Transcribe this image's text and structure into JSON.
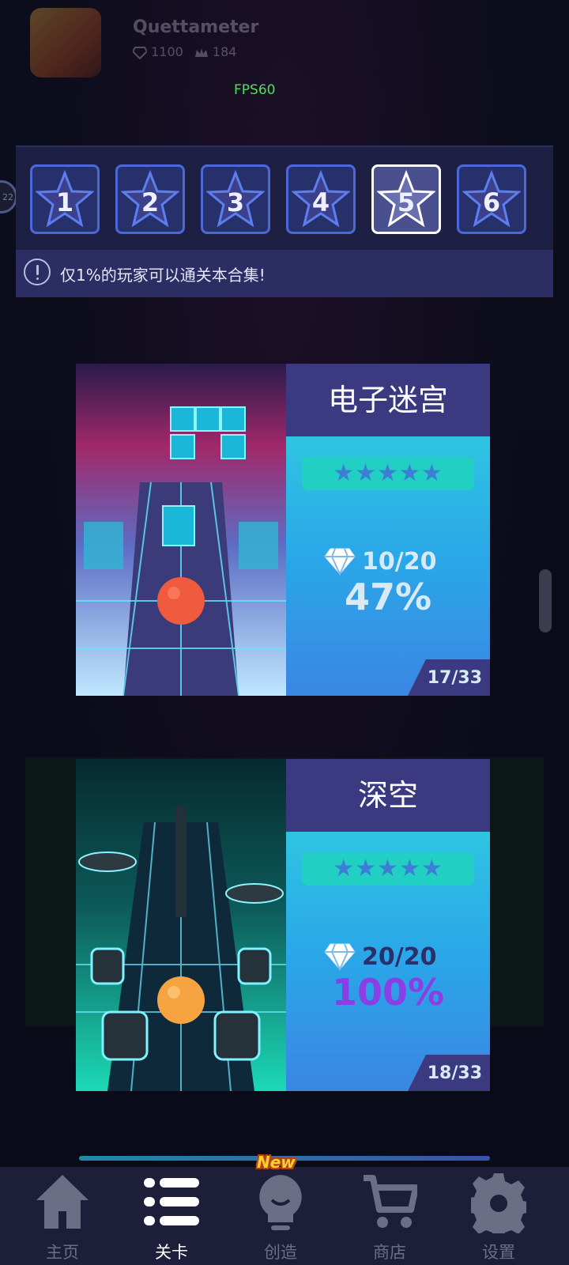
{
  "profile": {
    "name": "Quettameter",
    "gems": "1100",
    "crowns": "184"
  },
  "fps": "FPS60",
  "collection": {
    "tabs": [
      {
        "num": "1"
      },
      {
        "num": "2"
      },
      {
        "num": "3"
      },
      {
        "num": "4"
      },
      {
        "num": "5"
      },
      {
        "num": "6"
      }
    ],
    "selected_tab": "5",
    "notice_text": "仅1%的玩家可以通关本合集!"
  },
  "levels": [
    {
      "title": "电子迷宫",
      "stars": "★★★★★",
      "gems": "10/20",
      "percent": "47%",
      "index": "17/33"
    },
    {
      "title": "深空",
      "stars": "★★★★★",
      "gems": "20/20",
      "percent": "100%",
      "index": "18/33"
    }
  ],
  "side_badge": "22",
  "nav": {
    "items": [
      {
        "label": "主页",
        "icon": "home-icon"
      },
      {
        "label": "关卡",
        "icon": "list-icon"
      },
      {
        "label": "创造",
        "icon": "lightbulb-icon"
      },
      {
        "label": "商店",
        "icon": "cart-icon"
      },
      {
        "label": "设置",
        "icon": "gear-icon"
      }
    ],
    "active": "关卡",
    "new_badge": "New"
  },
  "colors": {
    "accent": "#4c67d8",
    "panel": "#1d2042",
    "info_title": "#3b3a80",
    "full_percent": "#8b3ee6",
    "fps": "#4ce05a"
  }
}
